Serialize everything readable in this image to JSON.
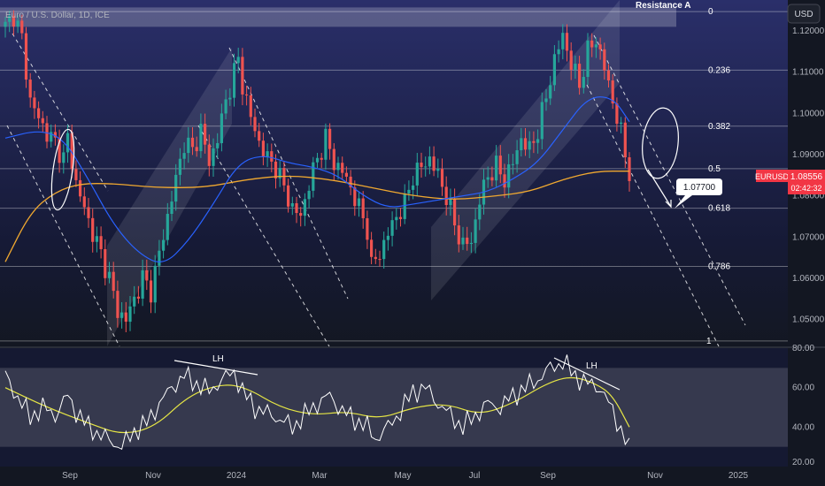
{
  "header": {
    "symbol_title": "Euro / U.S. Dollar, 1D, ICE",
    "currency_button": "USD"
  },
  "price_tag": {
    "ticker": "EURUSD",
    "price": "1.08556",
    "countdown": "02:42:32"
  },
  "annotations": {
    "resistance_label": "Resistance A",
    "target_label": "1.07700",
    "lh_left": "LH",
    "lh_right": "LH"
  },
  "colors": {
    "background": "#131722",
    "bull": "#26a69a",
    "bear": "#ef5350",
    "ma50": "#2962ff",
    "ma200": "#f0a830",
    "rsi": "#ffffff",
    "rsi_ma": "#e5e545",
    "price_tag": "#f23645"
  },
  "chart_data": [
    {
      "type": "line",
      "name": "price",
      "x_ticks": [
        "Sep",
        "Nov",
        "2024",
        "Mar",
        "May",
        "Jul",
        "Sep",
        "Nov",
        "2025"
      ],
      "y_ticks": [
        "1.12000",
        "1.11000",
        "1.10000",
        "1.09000",
        "1.08000",
        "1.07000",
        "1.06000",
        "1.05000"
      ],
      "ylim": [
        1.0435,
        1.1275
      ],
      "fib_levels": [
        {
          "label": "0",
          "value": 1.1247
        },
        {
          "label": "0.236",
          "value": 1.1105
        },
        {
          "label": "0.382",
          "value": 1.0969
        },
        {
          "label": "0.5",
          "value": 1.0866
        },
        {
          "label": "0.618",
          "value": 1.077
        },
        {
          "label": "0.786",
          "value": 1.0629
        },
        {
          "label": "1",
          "value": 1.0448
        }
      ],
      "last_price": 1.08556,
      "target": 1.077,
      "resistance_zone": [
        1.121,
        1.1257
      ],
      "close_path": [
        [
          0,
          1.121
        ],
        [
          2,
          1.124
        ],
        [
          4,
          1.118
        ],
        [
          6,
          1.103
        ],
        [
          8,
          1.099
        ],
        [
          10,
          1.095
        ],
        [
          12,
          1.093
        ],
        [
          14,
          1.089
        ],
        [
          15,
          1.094
        ],
        [
          17,
          1.083
        ],
        [
          19,
          1.077
        ],
        [
          21,
          1.071
        ],
        [
          23,
          1.066
        ],
        [
          25,
          1.06
        ],
        [
          27,
          1.052
        ],
        [
          29,
          1.05
        ],
        [
          31,
          1.055
        ],
        [
          33,
          1.06
        ],
        [
          35,
          1.057
        ],
        [
          37,
          1.066
        ],
        [
          39,
          1.075
        ],
        [
          41,
          1.084
        ],
        [
          43,
          1.093
        ],
        [
          45,
          1.091
        ],
        [
          47,
          1.096
        ],
        [
          49,
          1.088
        ],
        [
          51,
          1.094
        ],
        [
          53,
          1.103
        ],
        [
          55,
          1.11
        ],
        [
          56,
          1.113
        ],
        [
          57,
          1.107
        ],
        [
          59,
          1.099
        ],
        [
          61,
          1.093
        ],
        [
          63,
          1.089
        ],
        [
          65,
          1.087
        ],
        [
          67,
          1.082
        ],
        [
          69,
          1.077
        ],
        [
          71,
          1.075
        ],
        [
          73,
          1.083
        ],
        [
          75,
          1.089
        ],
        [
          77,
          1.094
        ],
        [
          79,
          1.088
        ],
        [
          81,
          1.086
        ],
        [
          83,
          1.082
        ],
        [
          85,
          1.077
        ],
        [
          87,
          1.072
        ],
        [
          88,
          1.063
        ],
        [
          90,
          1.066
        ],
        [
          92,
          1.071
        ],
        [
          94,
          1.075
        ],
        [
          96,
          1.078
        ],
        [
          98,
          1.085
        ],
        [
          100,
          1.087
        ],
        [
          102,
          1.089
        ],
        [
          104,
          1.085
        ],
        [
          106,
          1.08
        ],
        [
          108,
          1.073
        ],
        [
          110,
          1.068
        ],
        [
          112,
          1.069
        ],
        [
          114,
          1.079
        ],
        [
          116,
          1.085
        ],
        [
          118,
          1.087
        ],
        [
          120,
          1.084
        ],
        [
          122,
          1.088
        ],
        [
          124,
          1.094
        ],
        [
          126,
          1.091
        ],
        [
          128,
          1.096
        ],
        [
          130,
          1.104
        ],
        [
          132,
          1.113
        ],
        [
          134,
          1.119
        ],
        [
          136,
          1.112
        ],
        [
          138,
          1.107
        ],
        [
          140,
          1.115
        ],
        [
          142,
          1.118
        ],
        [
          144,
          1.111
        ],
        [
          146,
          1.103
        ],
        [
          148,
          1.095
        ],
        [
          150,
          1.0856
        ]
      ],
      "ma50_path": [
        [
          0,
          1.094
        ],
        [
          8,
          1.096
        ],
        [
          14,
          1.094
        ],
        [
          20,
          1.084
        ],
        [
          26,
          1.073
        ],
        [
          32,
          1.066
        ],
        [
          38,
          1.063
        ],
        [
          44,
          1.069
        ],
        [
          50,
          1.078
        ],
        [
          56,
          1.088
        ],
        [
          62,
          1.09
        ],
        [
          68,
          1.088
        ],
        [
          74,
          1.087
        ],
        [
          80,
          1.085
        ],
        [
          86,
          1.08
        ],
        [
          92,
          1.077
        ],
        [
          98,
          1.078
        ],
        [
          104,
          1.079
        ],
        [
          110,
          1.08
        ],
        [
          116,
          1.081
        ],
        [
          122,
          1.084
        ],
        [
          128,
          1.088
        ],
        [
          134,
          1.096
        ],
        [
          140,
          1.104
        ],
        [
          146,
          1.104
        ],
        [
          150,
          1.098
        ]
      ],
      "ma200_path": [
        [
          0,
          1.064
        ],
        [
          6,
          1.076
        ],
        [
          12,
          1.081
        ],
        [
          18,
          1.083
        ],
        [
          26,
          1.083
        ],
        [
          36,
          1.082
        ],
        [
          48,
          1.082
        ],
        [
          58,
          1.084
        ],
        [
          68,
          1.085
        ],
        [
          78,
          1.084
        ],
        [
          88,
          1.082
        ],
        [
          98,
          1.08
        ],
        [
          108,
          1.079
        ],
        [
          118,
          1.08
        ],
        [
          126,
          1.081
        ],
        [
          134,
          1.084
        ],
        [
          142,
          1.086
        ],
        [
          150,
          1.086
        ]
      ]
    },
    {
      "type": "line",
      "name": "rsi",
      "y_ticks": [
        "80.00",
        "60.00",
        "40.00",
        "20.00"
      ],
      "ylim": [
        20,
        80
      ],
      "band": [
        30,
        70
      ],
      "rsi_path": [
        [
          0,
          66
        ],
        [
          3,
          55
        ],
        [
          6,
          45
        ],
        [
          9,
          50
        ],
        [
          12,
          46
        ],
        [
          15,
          56
        ],
        [
          17,
          48
        ],
        [
          20,
          40
        ],
        [
          23,
          36
        ],
        [
          26,
          32
        ],
        [
          28,
          30
        ],
        [
          31,
          38
        ],
        [
          34,
          42
        ],
        [
          37,
          52
        ],
        [
          40,
          60
        ],
        [
          43,
          66
        ],
        [
          46,
          62
        ],
        [
          49,
          58
        ],
        [
          52,
          64
        ],
        [
          55,
          68
        ],
        [
          57,
          58
        ],
        [
          60,
          50
        ],
        [
          63,
          47
        ],
        [
          66,
          44
        ],
        [
          69,
          40
        ],
        [
          72,
          46
        ],
        [
          75,
          52
        ],
        [
          78,
          56
        ],
        [
          81,
          48
        ],
        [
          84,
          44
        ],
        [
          87,
          40
        ],
        [
          89,
          34
        ],
        [
          92,
          40
        ],
        [
          95,
          48
        ],
        [
          98,
          58
        ],
        [
          101,
          60
        ],
        [
          104,
          52
        ],
        [
          107,
          46
        ],
        [
          110,
          40
        ],
        [
          113,
          46
        ],
        [
          116,
          52
        ],
        [
          119,
          50
        ],
        [
          122,
          56
        ],
        [
          125,
          60
        ],
        [
          128,
          64
        ],
        [
          131,
          70
        ],
        [
          134,
          73
        ],
        [
          137,
          66
        ],
        [
          140,
          62
        ],
        [
          143,
          60
        ],
        [
          146,
          48
        ],
        [
          149,
          34
        ],
        [
          150,
          28
        ]
      ],
      "rsi_ma_path": [
        [
          0,
          60
        ],
        [
          10,
          50
        ],
        [
          20,
          42
        ],
        [
          28,
          36
        ],
        [
          36,
          40
        ],
        [
          44,
          56
        ],
        [
          52,
          62
        ],
        [
          58,
          60
        ],
        [
          66,
          50
        ],
        [
          74,
          46
        ],
        [
          82,
          48
        ],
        [
          90,
          44
        ],
        [
          98,
          50
        ],
        [
          106,
          52
        ],
        [
          114,
          46
        ],
        [
          122,
          52
        ],
        [
          130,
          62
        ],
        [
          136,
          66
        ],
        [
          142,
          62
        ],
        [
          146,
          56
        ],
        [
          150,
          40
        ]
      ]
    }
  ]
}
